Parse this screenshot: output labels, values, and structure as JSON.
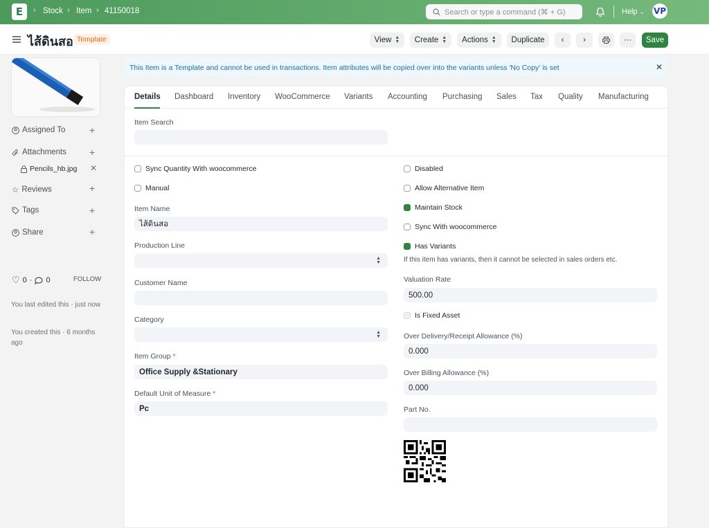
{
  "navbar": {
    "breadcrumbs": [
      "Stock",
      "Item",
      "41150018"
    ],
    "search_placeholder": "Search or type a command (⌘ + G)",
    "help_label": "Help",
    "avatar_initials": "VP"
  },
  "header": {
    "title": "ไส้ดินสอ",
    "status_pill": "Template",
    "buttons": {
      "view": "View",
      "create": "Create",
      "actions": "Actions",
      "duplicate": "Duplicate",
      "save": "Save"
    }
  },
  "sidebar": {
    "assigned_to": "Assigned To",
    "attachments": "Attachments",
    "attachment_file": "Pencils_hb.jpg",
    "reviews": "Reviews",
    "tags": "Tags",
    "share": "Share",
    "likes_count": "0",
    "comments_count": "0",
    "follow_label": "FOLLOW",
    "last_edited": "You last edited this · just now",
    "created": "You created this · 6 months ago"
  },
  "alert": {
    "message": "This Item is a Template and cannot be used in transactions. Item attributes will be copied over into the variants unless 'No Copy' is set"
  },
  "tabs": [
    "Details",
    "Dashboard",
    "Inventory",
    "WooCommerce",
    "Variants",
    "Accounting",
    "Purchasing",
    "Sales",
    "Tax",
    "Quality",
    "Manufacturing"
  ],
  "form": {
    "item_search_label": "Item Search",
    "item_search_value": "",
    "left_checkboxes": [
      {
        "label": "Sync Quantity With woocommerce",
        "checked": false
      },
      {
        "label": "Manual",
        "checked": false
      }
    ],
    "item_name_label": "Item Name",
    "item_name_value": "ไส้ดินสอ",
    "production_line_label": "Production Line",
    "production_line_value": "",
    "customer_name_label": "Customer Name",
    "customer_name_value": "",
    "category_label": "Category",
    "category_value": "",
    "item_group_label": "Item Group",
    "item_group_value": "Office Supply &Stationary",
    "uom_label": "Default Unit of Measure",
    "uom_value": "Pc",
    "required_marker": "*",
    "right_checkboxes": [
      {
        "label": "Disabled",
        "checked": false
      },
      {
        "label": "Allow Alternative Item",
        "checked": false
      },
      {
        "label": "Maintain Stock",
        "checked": true
      },
      {
        "label": "Sync With woocommerce",
        "checked": false
      },
      {
        "label": "Has Variants",
        "checked": true
      }
    ],
    "has_variants_help": "If this item has variants, then it cannot be selected in sales orders etc.",
    "valuation_rate_label": "Valuation Rate",
    "valuation_rate_value": "500.00",
    "is_fixed_asset_label": "Is Fixed Asset",
    "over_delivery_label": "Over Delivery/Receipt Allowance (%)",
    "over_delivery_value": "0.000",
    "over_billing_label": "Over Billing Allowance (%)",
    "over_billing_value": "0.000",
    "part_no_label": "Part No.",
    "part_no_value": ""
  },
  "colors": {
    "brand": "#2e8542",
    "pill_text": "#e86c13",
    "alert_text": "#1e6ea5"
  }
}
